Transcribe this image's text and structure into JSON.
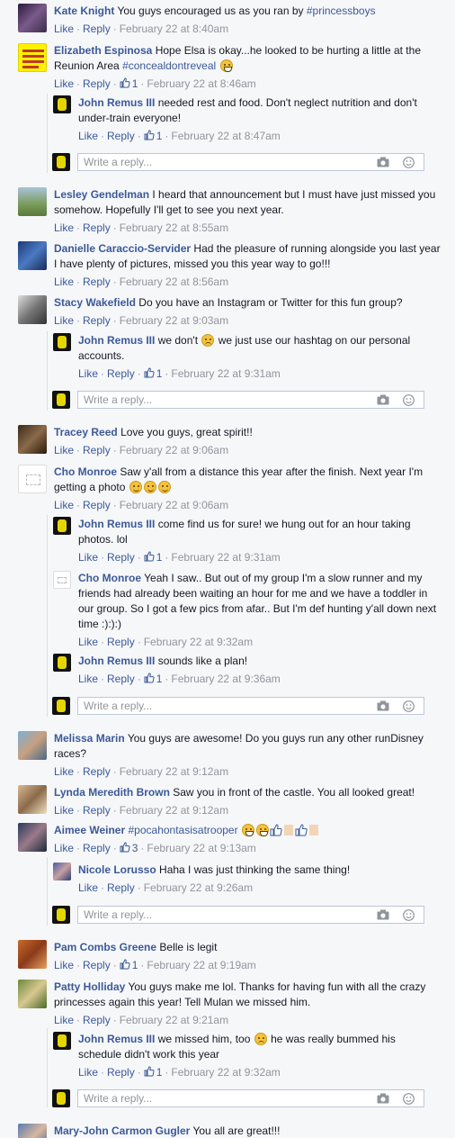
{
  "labels": {
    "like": "Like",
    "reply": "Reply",
    "write_reply": "Write a reply..."
  },
  "comments": {
    "kate": {
      "author": "Kate Knight",
      "text": "You guys encouraged us as you ran by",
      "tag": "#princessboys",
      "time": "February 22 at 8:40am"
    },
    "elizabeth": {
      "author": "Elizabeth Espinosa",
      "text": "Hope Elsa is okay...he looked to be hurting a little at the Reunion Area",
      "tag": "#concealdontreveal",
      "likes": "1",
      "time": "February 22 at 8:46am"
    },
    "john1": {
      "author": "John Remus III",
      "text": "needed rest and food. Don't neglect nutrition and don't under-train everyone!",
      "likes": "1",
      "time": "February 22 at 8:47am"
    },
    "lesley": {
      "author": "Lesley Gendelman",
      "text": "I heard that announcement but I must have just missed you somehow. Hopefully I'll get to see you next year.",
      "time": "February 22 at 8:55am"
    },
    "danielle": {
      "author": "Danielle Caraccio-Servider",
      "text": "Had the pleasure of running alongside you last year I have plenty of pictures, missed you this year way to go!!!",
      "time": "February 22 at 8:56am"
    },
    "stacy": {
      "author": "Stacy Wakefield",
      "text": "Do you have an Instagram or Twitter for this fun group?",
      "time": "February 22 at 9:03am"
    },
    "john2": {
      "author": "John Remus III",
      "text_a": "we don't",
      "text_b": "we just use our hashtag on our personal accounts.",
      "likes": "1",
      "time": "February 22 at 9:31am"
    },
    "tracey": {
      "author": "Tracey Reed",
      "text": "Love you guys, great spirit!!",
      "time": "February 22 at 9:06am"
    },
    "cho1": {
      "author": "Cho Monroe",
      "text": "Saw y'all from a distance this year after the finish. Next year I'm getting a photo",
      "time": "February 22 at 9:06am"
    },
    "john3": {
      "author": "John Remus III",
      "text": "come find us for sure! we hung out for an hour taking photos. lol",
      "likes": "1",
      "time": "February 22 at 9:31am"
    },
    "cho2": {
      "author": "Cho Monroe",
      "text": "Yeah I saw.. But out of my group I'm a slow runner and my friends had already been waiting an hour for me and we have a toddler in our group. So I got a few pics from afar.. But I'm def hunting y'all down next time :):):)",
      "time": "February 22 at 9:32am"
    },
    "john4": {
      "author": "John Remus III",
      "text": "sounds like a plan!",
      "likes": "1",
      "time": "February 22 at 9:36am"
    },
    "melissa": {
      "author": "Melissa Marin",
      "text": "You guys are awesome! Do you guys run any other runDisney races?",
      "time": "February 22 at 9:12am"
    },
    "lynda": {
      "author": "Lynda Meredith Brown",
      "text": "Saw you in front of the castle. You all looked great!",
      "time": "February 22 at 9:12am"
    },
    "aimee": {
      "author": "Aimee Weiner",
      "tag": "#pocahontasisatrooper",
      "likes": "3",
      "time": "February 22 at 9:13am"
    },
    "nicole": {
      "author": "Nicole Lorusso",
      "text": "Haha I was just thinking the same thing!",
      "time": "February 22 at 9:26am"
    },
    "pam": {
      "author": "Pam Combs Greene",
      "text": "Belle is legit",
      "likes": "1",
      "time": "February 22 at 9:19am"
    },
    "patty": {
      "author": "Patty Holliday",
      "text": "You guys make me lol. Thanks for having fun with all the crazy princesses again this year! Tell Mulan we missed him.",
      "time": "February 22 at 9:21am"
    },
    "john5": {
      "author": "John Remus III",
      "text_a": "we missed him, too",
      "text_b": "he was really bummed his schedule didn't work this year",
      "likes": "1",
      "time": "February 22 at 9:32am"
    },
    "mary": {
      "author": "Mary-John Carmon Gugler",
      "text": "You all are great!!!"
    }
  },
  "icons": {
    "like": "thumbs-up-icon",
    "camera": "camera-icon",
    "smiley": "smiley-icon"
  },
  "colors": {
    "link": "#3b5998",
    "meta": "#90949c",
    "background": "#f6f7f9"
  }
}
